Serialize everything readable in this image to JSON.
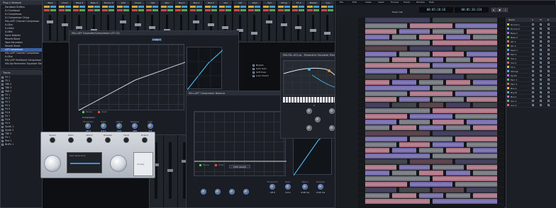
{
  "left_browser": {
    "items": [
      "Hardware Buffers",
      "ILI Chordpool",
      "ILI Compressor",
      "ILI Compressor Chlng",
      "Mix-LAFF Channel Compressor",
      "ILI-Dyn",
      "ILI-Gate",
      "ILI-Mid",
      "Dyna Adapter",
      "Reverb Boost",
      "Tape Saturation",
      "Reverb Sheet",
      "LLP Compressor",
      "Mix-LAFF Channel Compressor",
      "ILI-Dyn",
      "Mix-LAFF Multiband Compressor",
      "Mix-Vip Parametric Equalizer Stereo"
    ],
    "selected_index": 12,
    "track_section": "Tracks",
    "tracks": [
      "FX 1",
      "FX 2",
      "TRK 2",
      "TRK 3",
      "PAD 1",
      "FX 1",
      "FX 2",
      "FX 3",
      "FX 4",
      "FX 5",
      "FX 6",
      "FX 7",
      "FX 8",
      "FX 9",
      "Synth 1",
      "Synth 2",
      "TRK 3",
      "FX 1",
      "Perc 1",
      "BrdFx 1"
    ]
  },
  "mixer": {
    "channels": [
      "Bass",
      "Drum",
      "Bass 3",
      "Bass 3",
      "Drums 3",
      "Kick",
      "Snare",
      "Hat",
      "Perc",
      "Bus 1",
      "Bus 2",
      "Bus 3",
      "Vox",
      "Gtr",
      "Keys",
      "Pad",
      "Strng",
      "FX 1",
      "Master",
      "Aux"
    ]
  },
  "transport": {
    "time_1": "00:05:28:16",
    "time_2": "00:05:26:224",
    "menu": [
      "File",
      "Edit",
      "Views",
      "Insert",
      "Process",
      "Tracks",
      "Window",
      "Help"
    ],
    "project": "Music Lab"
  },
  "compressor_1": {
    "title": "Mix-LAFF Expander/Compressor (ZF-CX)",
    "mode": "Compressor",
    "labels": [
      "Threshold",
      "Ratio",
      "Attack",
      "Release",
      "Gain"
    ],
    "values": [
      "-20.0",
      "4.0:1",
      "10.0",
      "100",
      "0.0"
    ],
    "options": [
      "Bypass",
      "Auto Gain",
      "Soft Knee",
      "Look Ahead"
    ],
    "legend": [
      "Pause",
      "Clear"
    ]
  },
  "compressor_2": {
    "title": "Mix-LAFF Compressor Balance",
    "labels": [
      "Threshold",
      "Ratio",
      "Attack",
      "Release"
    ],
    "values": [
      "-18.5",
      "3.0:1",
      "4.48 ms",
      "0.00 ms"
    ],
    "legend": [
      "Pause",
      "Clear"
    ],
    "tab": "TIME GRAPH"
  },
  "eq": {
    "title": "MIX-FAL-cEQ.vp - Parametric Equalizer Mono (per Mode General)",
    "bands": [
      "1",
      "2",
      "3",
      "4",
      "5"
    ]
  },
  "vintage_comp": {
    "labels": [
      "Speed",
      "Ratio",
      "Attack",
      "Release",
      "Input",
      "Output"
    ],
    "meter": "Gain Reduction",
    "brand": "Analog"
  },
  "track_list": {
    "tracks": [
      "Drums 1",
      "Drums 2",
      "Bass 1",
      "Bass 2",
      "Gtr 1",
      "Gtr 2",
      "Keys 1",
      "Pad 1",
      "Vox 1",
      "Vox 2",
      "FX 1",
      "Strings",
      "Synth",
      "Perc 1",
      "Perc 2",
      "Bus A",
      "Bus B",
      "Bus C",
      "Aux 1",
      "Aux 2"
    ],
    "columns": [
      "Name",
      "S",
      "M",
      "R"
    ]
  },
  "colors": {
    "accent": "#3f8df0",
    "curve": "#4fb2e8",
    "clip_purple": "#8d7fd0",
    "clip_pink": "#d58ca0",
    "clip_gray": "#8a8f96"
  }
}
